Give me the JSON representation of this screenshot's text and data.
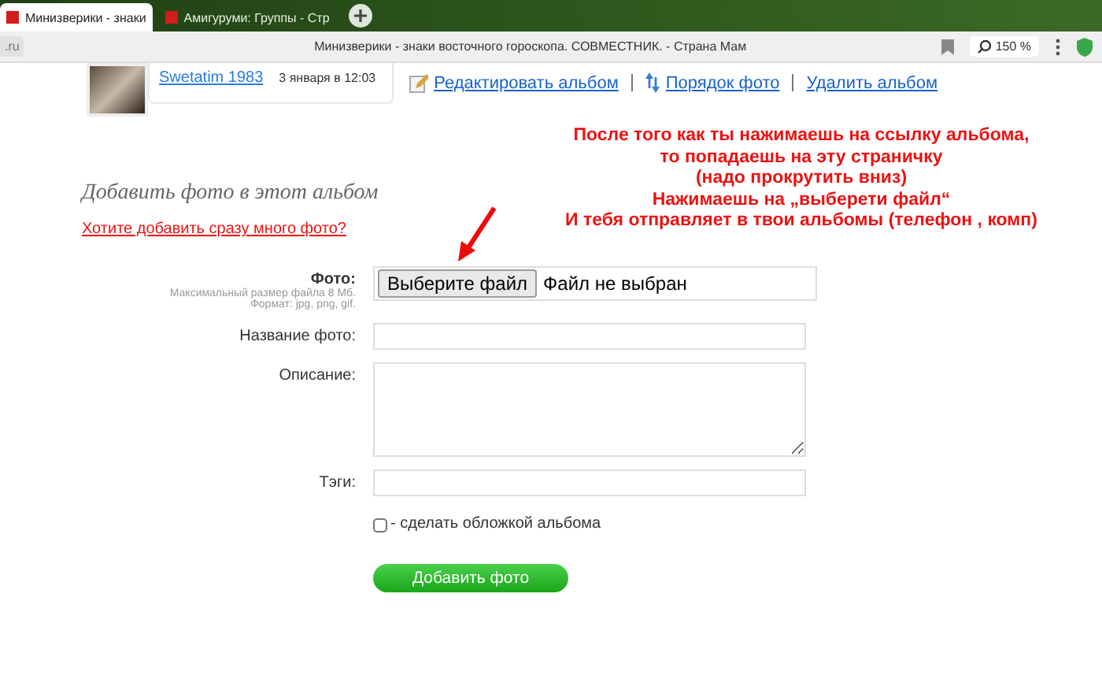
{
  "browser": {
    "tabs": [
      {
        "label": "Минизверики - знаки",
        "selected": true
      },
      {
        "label": "Амигуруми: Группы - Стр",
        "selected": false
      }
    ],
    "address": ".ru",
    "page_title": "Минизверики - знаки восточного гороскопа. СОВМЕСТНИК. - Страна Мам",
    "zoom": "150 %"
  },
  "album": {
    "author": "Swetatim 1983",
    "date": "3 января в 12:03",
    "actions": [
      {
        "label": "Редактировать альбом",
        "kind": "edit"
      },
      {
        "label": "Порядок фото",
        "kind": "order"
      },
      {
        "label": "Удалить альбом",
        "kind": "plain"
      }
    ]
  },
  "annotation": [
    "После того как ты нажимаешь на ссылку альбома,",
    "то попадаешь на эту страничку",
    "(надо прокрутить вниз)",
    "Нажимаешь на „выберети файл“",
    "И тебя отправляет в твои альбомы (телефон , комп)"
  ],
  "form": {
    "heading": "Добавить фото в этот альбом",
    "bulk_link": "Хотите добавить сразу много фото?",
    "photo": {
      "label": "Фото:",
      "hint": [
        "Максимальный размер файла 8 Мб.",
        "Формат: jpg, png, gif."
      ],
      "button": "Выберите файл",
      "status": "Файл не выбран"
    },
    "fields": [
      {
        "label": "Название фото:",
        "kind": "text"
      },
      {
        "label": "Описание:",
        "kind": "textarea"
      },
      {
        "label": "Тэги:",
        "kind": "text"
      }
    ],
    "cover": {
      "label": "- сделать обложкой альбома",
      "checked": false
    },
    "submit": "Добавить фото"
  }
}
